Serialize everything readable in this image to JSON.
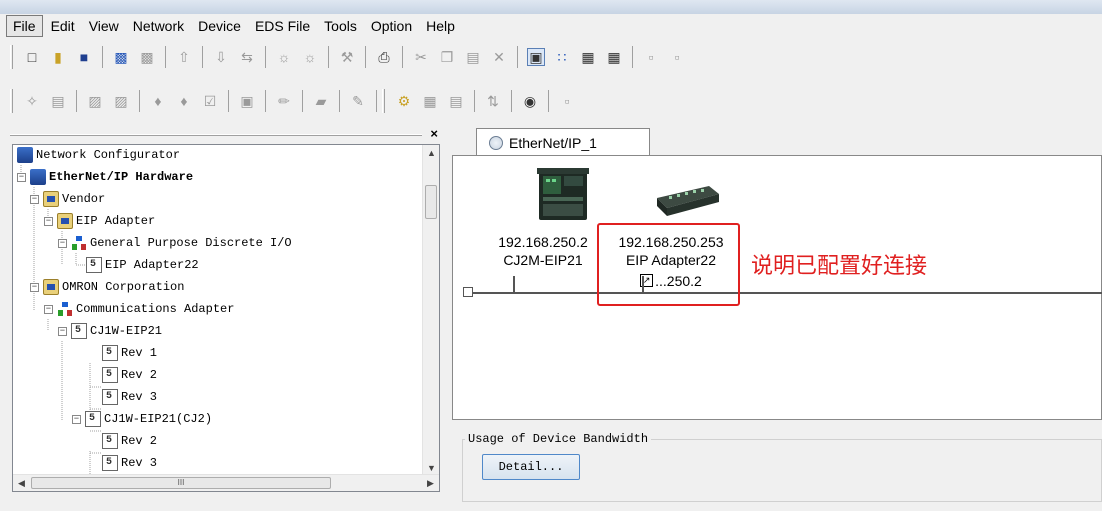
{
  "menu": [
    "File",
    "Edit",
    "View",
    "Network",
    "Device",
    "EDS File",
    "Tools",
    "Option",
    "Help"
  ],
  "tree": {
    "root": "Network Configurator",
    "hardware": "EtherNet/IP Hardware",
    "vendor": "Vendor",
    "eip_adapter": "EIP Adapter",
    "gp_io": "General Purpose Discrete I/O",
    "eip_adapter22": "EIP Adapter22",
    "omron": "OMRON Corporation",
    "comm_adapter": "Communications Adapter",
    "cj1w": "CJ1W-EIP21",
    "rev1": "Rev 1",
    "rev2": "Rev 2",
    "rev3": "Rev 3",
    "cj1w_cj2": "CJ1W-EIP21(CJ2)",
    "rev2b": "Rev 2",
    "rev3b": "Rev 3",
    "hscroll_thumb": "III"
  },
  "tab": {
    "label": "EtherNet/IP_1"
  },
  "devices": [
    {
      "ip": "192.168.250.2",
      "name": "CJ2M-EIP21"
    },
    {
      "ip": "192.168.250.253",
      "name": "EIP Adapter22",
      "link": "...250.2"
    }
  ],
  "annotation": "说明已配置好连接",
  "usage": {
    "legend": "Usage of Device Bandwidth",
    "detail_button": "Detail..."
  },
  "colors": {
    "highlight": "#e02020",
    "tab_bg": "#ffffff",
    "canvas_bg": "#ffffff"
  }
}
